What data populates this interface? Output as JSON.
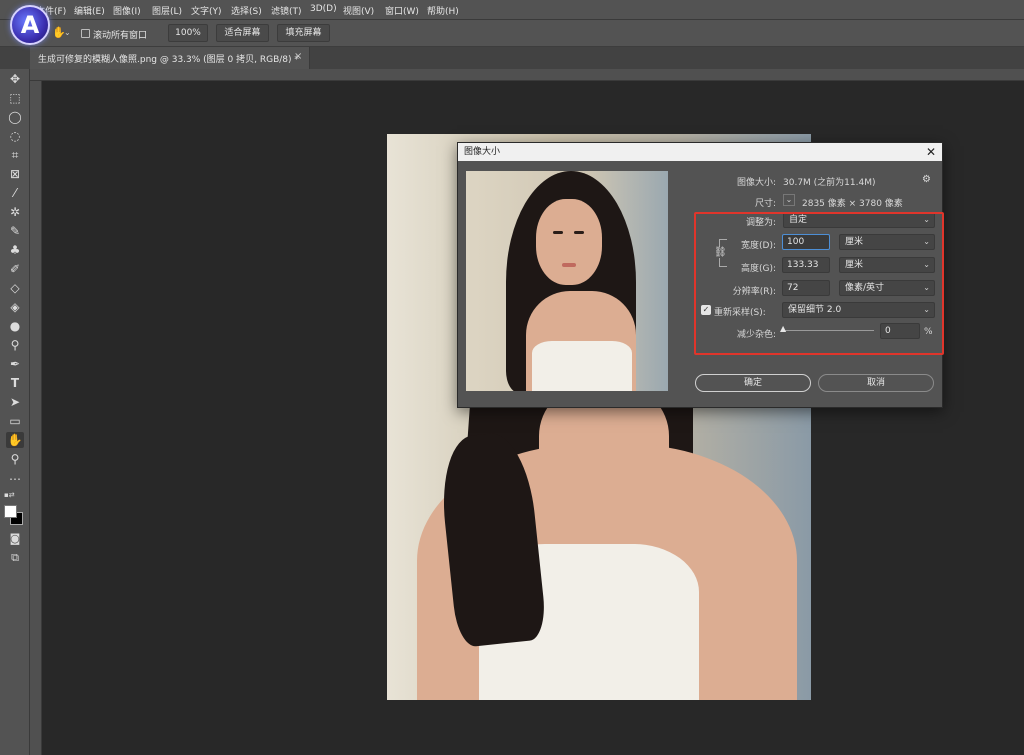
{
  "menu": [
    "文件(F)",
    "编辑(E)",
    "图像(I)",
    "图层(L)",
    "文字(Y)",
    "选择(S)",
    "滤镜(T)",
    "3D(D)",
    "视图(V)",
    "窗口(W)",
    "帮助(H)"
  ],
  "options": {
    "scroll_all_label": "滚动所有窗口",
    "zoom_btn": "100%",
    "fit_btn": "适合屏幕",
    "fill_btn": "填充屏幕"
  },
  "doc_tab": {
    "title": "生成可修复的模糊人像照.png @ 33.3% (图层 0 拷贝, RGB/8) *",
    "close": "×"
  },
  "logo_letter": "A",
  "dialog": {
    "title": "图像大小",
    "close": "✕",
    "image_size_label": "图像大小:",
    "image_size_value": "30.7M (之前为11.4M)",
    "dimensions_label": "尺寸:",
    "dimensions_value": "2835 像素 × 3780 像素",
    "fit_to_label": "调整为:",
    "fit_to_value": "自定",
    "width_label": "宽度(D):",
    "width_value": "100",
    "width_unit": "厘米",
    "height_label": "高度(G):",
    "height_value": "133.33",
    "height_unit": "厘米",
    "resolution_label": "分辨率(R):",
    "resolution_value": "72",
    "resolution_unit": "像素/英寸",
    "resample_label": "重新采样(S):",
    "resample_checked": true,
    "resample_method": "保留细节 2.0",
    "reduce_noise_label": "减少杂色:",
    "reduce_noise_value": "0",
    "reduce_noise_unit": "%",
    "ok_label": "确定",
    "cancel_label": "取消"
  },
  "colors": {
    "highlight_box": "#e0352b",
    "focus_border": "#4d8fd6"
  }
}
